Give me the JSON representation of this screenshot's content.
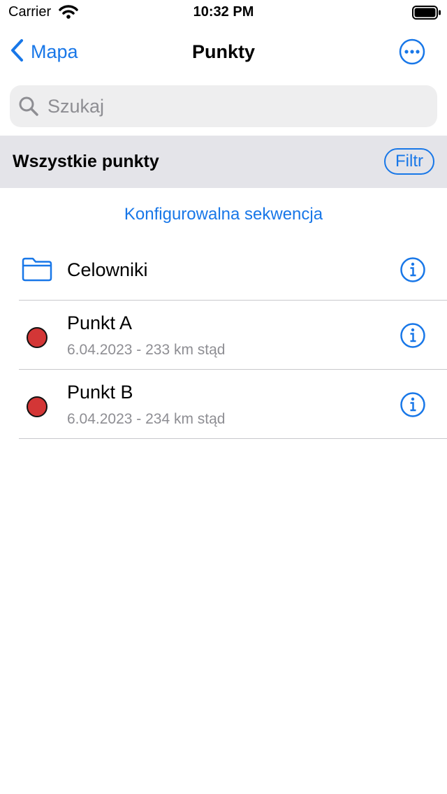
{
  "status_bar": {
    "carrier": "Carrier",
    "time": "10:32 PM"
  },
  "nav": {
    "back_label": "Mapa",
    "title": "Punkty"
  },
  "search": {
    "placeholder": "Szukaj"
  },
  "section": {
    "title": "Wszystkie punkty",
    "filter_label": "Filtr"
  },
  "sequence_link": "Konfigurowalna sekwencja",
  "list": {
    "folder": {
      "label": "Celowniki"
    },
    "points": [
      {
        "name": "Punkt A",
        "detail": "6.04.2023 - 233 km stąd"
      },
      {
        "name": "Punkt B",
        "detail": "6.04.2023 - 234 km stąd"
      }
    ]
  },
  "colors": {
    "accent": "#1877e8",
    "marker": "#d33636",
    "section_bg": "#e4e4e9",
    "search_bg": "#eeeeef"
  },
  "icons": [
    "wifi-icon",
    "battery-icon",
    "chevron-left-icon",
    "more-icon",
    "search-icon",
    "folder-icon",
    "info-icon"
  ]
}
